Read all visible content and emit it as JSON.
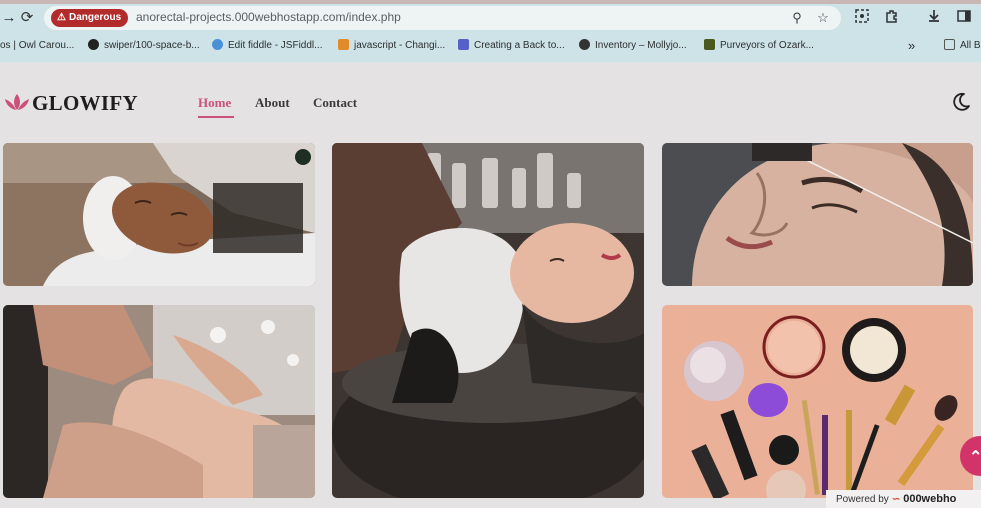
{
  "browser": {
    "security_chip": "Dangerous",
    "url": "anorectal-projects.000webhostapp.com/index.php",
    "bookmarks": [
      {
        "label": "os | Owl Carou...",
        "icon": "owl-icon",
        "color": "#8a6b2e"
      },
      {
        "label": "swiper/100-space-b...",
        "icon": "github-icon",
        "color": "#222222"
      },
      {
        "label": "Edit fiddle - JSFiddl...",
        "icon": "cloud-icon",
        "color": "#4a90d9"
      },
      {
        "label": "javascript - Changi...",
        "icon": "stackoverflow-icon",
        "color": "#e38b2c"
      },
      {
        "label": "Creating a Back to...",
        "icon": "site-icon",
        "color": "#5560c9"
      },
      {
        "label": "Inventory – Mollyjo...",
        "icon": "globe-icon",
        "color": "#333333"
      },
      {
        "label": "Purveyors of Ozark...",
        "icon": "site-icon",
        "color": "#4b5a1e"
      },
      {
        "label": "»",
        "icon": "more-icon",
        "color": "#333333"
      },
      {
        "label": "All B",
        "icon": "folder-icon",
        "color": "#555555"
      }
    ]
  },
  "site": {
    "brand": "GLOWIFY",
    "nav": [
      {
        "label": "Home",
        "active": true
      },
      {
        "label": "About",
        "active": false
      },
      {
        "label": "Contact",
        "active": false
      }
    ],
    "accent_color": "#c9517a",
    "theme_toggle_icon": "moon-icon"
  },
  "gallery": {
    "images": [
      {
        "name": "facial-mask-image",
        "subject": "woman receiving facial clay mask"
      },
      {
        "name": "hair-wash-image",
        "subject": "woman getting hair washed at salon sink"
      },
      {
        "name": "eyebrow-threading-image",
        "subject": "woman getting eyebrow threading"
      },
      {
        "name": "foot-massage-image",
        "subject": "foot massage"
      },
      {
        "name": "makeup-products-image",
        "subject": "makeup products flat lay"
      }
    ]
  },
  "footer": {
    "powered_prefix": "Powered by",
    "powered_brand": "000webho",
    "scroll_top_icon": "chevron-up-icon",
    "fab_color": "#d2346a"
  }
}
